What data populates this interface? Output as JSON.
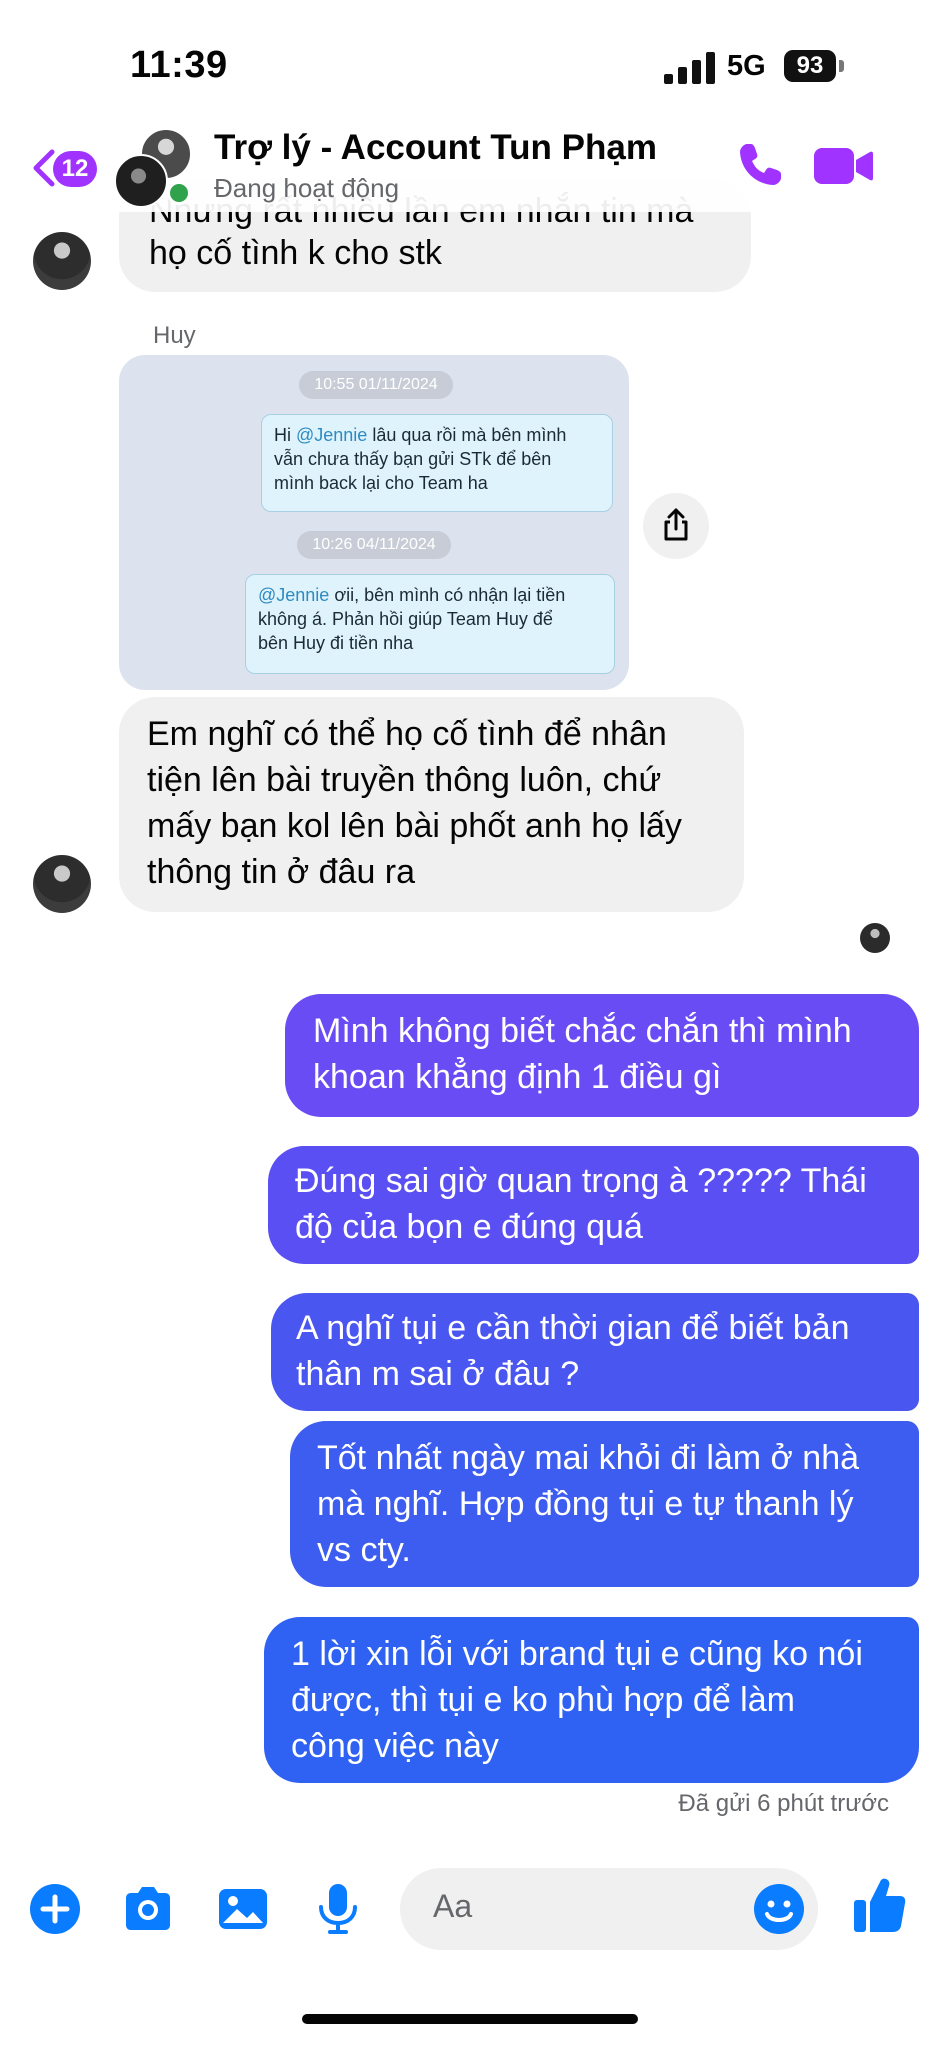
{
  "status_bar": {
    "time": "11:39",
    "network": "5G",
    "battery": "93"
  },
  "header": {
    "back_badge": "12",
    "title": "Trợ lý - Account Tun Phạm",
    "subtitle": "Đang hoạt động",
    "accent_color": "#a033ff"
  },
  "messages": {
    "incoming_partial_line1": "Nhưng rất nhiều lần em nhắn tin mà",
    "incoming_partial_line2": "họ cố tình k cho stk",
    "shared_sender": "Huy",
    "shared_card": {
      "timestamp1": "10:55 01/11/2024",
      "mention1": "@Jennie",
      "msg1_line1_rest": " lâu qua rồi mà bên mình",
      "msg1_prefix": "Hi ",
      "msg1_line2": "vẫn chưa thấy bạn gửi STk để bên",
      "msg1_line3": "mình back lại cho Team ha",
      "timestamp2": "10:26 04/11/2024",
      "mention2": "@Jennie",
      "msg2_line1_rest": " ơii, bên mình có nhận lại tiền",
      "msg2_line2": "không á. Phản hồi giúp Team Huy để",
      "msg2_line3": "bên Huy đi tiền nha"
    },
    "incoming2": [
      "Em nghĩ có thể họ cố tình để nhân",
      "tiện lên bài truyền thông luôn, chứ",
      "mấy bạn kol lên bài phốt anh họ lấy",
      "thông tin ở đâu ra"
    ],
    "outgoing": [
      {
        "lines": [
          "Mình không biết chắc chắn thì mình",
          "khoan khẳng định 1 điều gì"
        ],
        "color": "#6a4cf5"
      },
      {
        "lines": [
          "Đúng sai giờ quan trọng à ????? Thái",
          "độ của bọn e đúng quá"
        ],
        "color": "#5a4ff2"
      },
      {
        "lines": [
          "A nghĩ tụi e cần thời gian để biết bản",
          "thân m sai ở đâu ?"
        ],
        "color": "#4a56f0"
      },
      {
        "lines": [
          "Tốt nhất ngày mai khỏi đi làm ở nhà",
          "mà nghĩ. Hợp đồng tụi e tự thanh lý",
          "vs cty."
        ],
        "color": "#3d5cf0"
      },
      {
        "lines": [
          "1 lời xin lỗi với brand tụi e cũng ko nói",
          "được, thì tụi e ko phù hợp để làm",
          "công việc này"
        ],
        "color": "#2f62f2"
      }
    ],
    "sent_status": "Đã gửi 6 phút trước"
  },
  "composer": {
    "placeholder": "Aa",
    "icon_color": "#0a7cff",
    "icons": [
      "plus-icon",
      "camera-icon",
      "gallery-icon",
      "microphone-icon",
      "emoji-icon",
      "thumbs-up-icon"
    ]
  }
}
